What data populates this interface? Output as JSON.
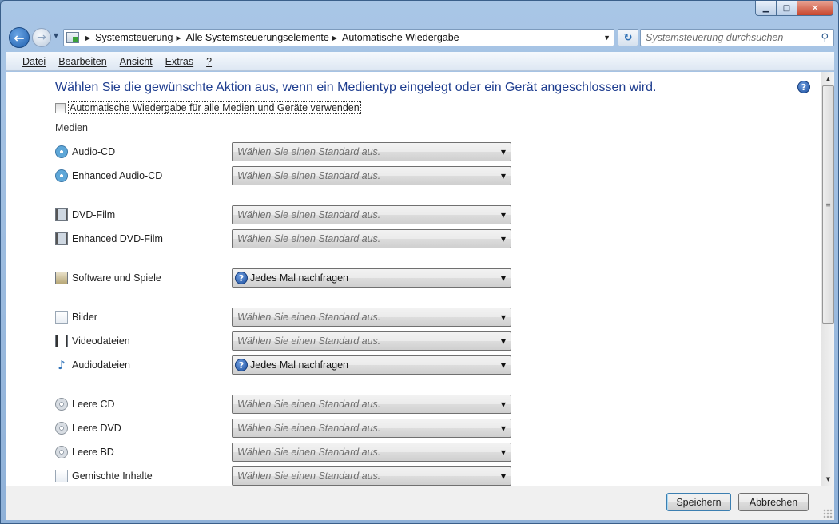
{
  "window": {
    "caption_buttons": [
      "minimize",
      "maximize",
      "close"
    ]
  },
  "navigation": {
    "breadcrumbs": [
      "Systemsteuerung",
      "Alle Systemsteuerungselemente",
      "Automatische Wiedergabe"
    ],
    "search_placeholder": "Systemsteuerung durchsuchen"
  },
  "menubar": {
    "items": [
      "Datei",
      "Bearbeiten",
      "Ansicht",
      "Extras",
      "?"
    ]
  },
  "main": {
    "heading": "Wählen Sie die gewünschte Aktion aus, wenn ein Medientyp eingelegt oder ein Gerät angeschlossen wird.",
    "autoplay_checkbox_label": "Automatische Wiedergabe für alle Medien und Geräte verwenden",
    "autoplay_checked": false,
    "section_label": "Medien",
    "default_placeholder": "Wählen Sie einen Standard aus.",
    "rows": [
      {
        "label": "Audio-CD",
        "icon": "audio-cd-icon",
        "value": "Wählen Sie einen Standard aus.",
        "ask": false
      },
      {
        "label": "Enhanced Audio-CD",
        "icon": "audio-cd-icon",
        "value": "Wählen Sie einen Standard aus.",
        "ask": false
      },
      {
        "label": "DVD-Film",
        "icon": "dvd-icon",
        "value": "Wählen Sie einen Standard aus.",
        "ask": false
      },
      {
        "label": "Enhanced DVD-Film",
        "icon": "dvd-icon",
        "value": "Wählen Sie einen Standard aus.",
        "ask": false
      },
      {
        "label": "Software und Spiele",
        "icon": "software-icon",
        "value": "Jedes Mal nachfragen",
        "ask": true
      },
      {
        "label": "Bilder",
        "icon": "pictures-icon",
        "value": "Wählen Sie einen Standard aus.",
        "ask": false
      },
      {
        "label": "Videodateien",
        "icon": "video-file-icon",
        "value": "Wählen Sie einen Standard aus.",
        "ask": false
      },
      {
        "label": "Audiodateien",
        "icon": "music-note-icon",
        "value": "Jedes Mal nachfragen",
        "ask": true
      },
      {
        "label": "Leere CD",
        "icon": "blank-cd-icon",
        "value": "Wählen Sie einen Standard aus.",
        "ask": false
      },
      {
        "label": "Leere DVD",
        "icon": "blank-dvd-icon",
        "value": "Wählen Sie einen Standard aus.",
        "ask": false
      },
      {
        "label": "Leere BD",
        "icon": "blank-bd-icon",
        "value": "Wählen Sie einen Standard aus.",
        "ask": false
      },
      {
        "label": "Gemischte Inhalte",
        "icon": "mixed-content-icon",
        "value": "Wählen Sie einen Standard aus.",
        "ask": false
      }
    ]
  },
  "footer": {
    "save_label": "Speichern",
    "cancel_label": "Abbrechen"
  },
  "colors": {
    "heading": "#1e3d8f",
    "frame": "#a9c6e6",
    "content_bg": "#ffffff"
  }
}
